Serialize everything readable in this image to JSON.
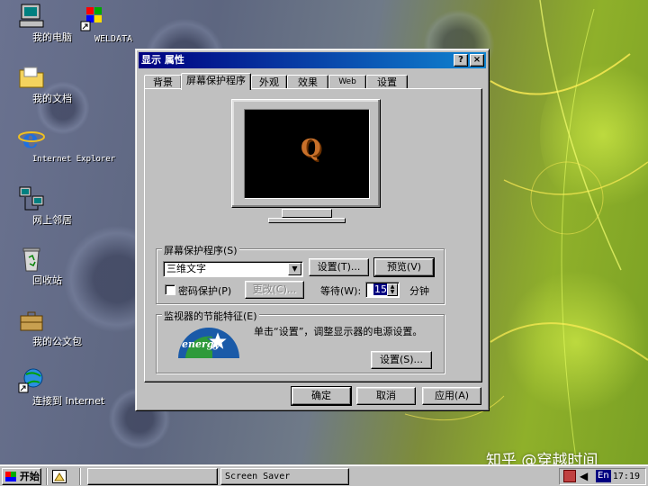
{
  "desktop": {
    "icons": [
      {
        "label": "我的电脑"
      },
      {
        "label": "WELDATA"
      },
      {
        "label": "我的文档"
      },
      {
        "label": "Internet Explorer"
      },
      {
        "label": "网上邻居"
      },
      {
        "label": "回收站"
      },
      {
        "label": "我的公文包"
      },
      {
        "label": "连接到 Internet"
      }
    ]
  },
  "window": {
    "title": "显示 属性",
    "help_btn": "?",
    "close_btn": "×",
    "tabs": [
      "背景",
      "屏幕保护程序",
      "外观",
      "效果",
      "Web",
      "设置"
    ],
    "active_tab": "屏幕保护程序",
    "preview_glyph": "Q",
    "screensaver": {
      "group_label": "屏幕保护程序(S)",
      "selected": "三维文字",
      "settings_btn": "设置(T)...",
      "preview_btn": "预览(V)",
      "password_label": "密码保护(P)",
      "password_checked": false,
      "change_btn": "更改(C)...",
      "wait_label": "等待(W):",
      "wait_value": "15",
      "wait_unit": "分钟"
    },
    "energy": {
      "group_label": "监视器的节能特征(E)",
      "logo_text": "energy",
      "description": "单击“设置”，调整显示器的电源设置。",
      "settings_btn": "设置(S)..."
    },
    "ok_btn": "确定",
    "cancel_btn": "取消",
    "apply_btn": "应用(A)"
  },
  "taskbar": {
    "start_label": "开始",
    "task_label": "Screen Saver",
    "lang": "En",
    "clock": "17:19"
  },
  "watermark": "知乎 @穿越时间"
}
